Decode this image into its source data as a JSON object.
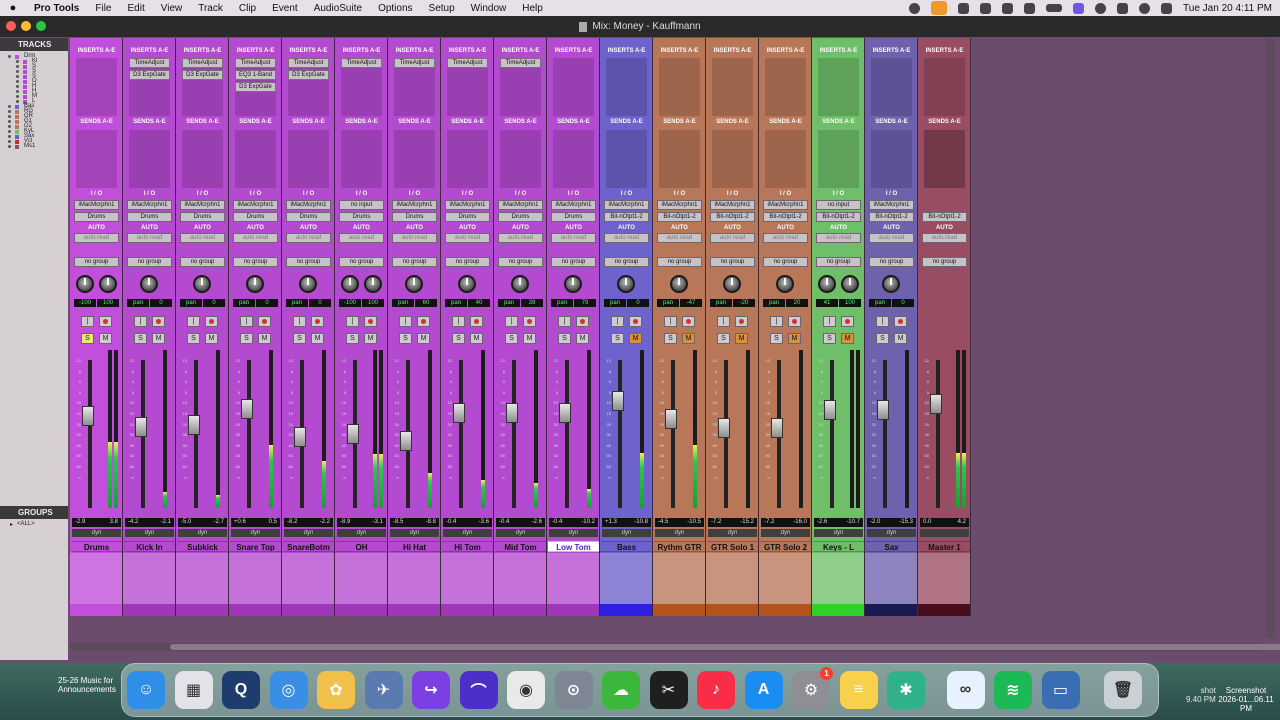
{
  "menubar": {
    "app_name": "Pro Tools",
    "items": [
      "File",
      "Edit",
      "View",
      "Track",
      "Clip",
      "Event",
      "AudioSuite",
      "Options",
      "Setup",
      "Window",
      "Help"
    ],
    "clock": "Tue Jan 20  4:11 PM"
  },
  "window": {
    "title": "Mix: Money - Kauffmann"
  },
  "panels": {
    "tracks_label": "TRACKS",
    "groups_label": "GROUPS",
    "tracks": [
      "Drm",
      "Kl",
      "S",
      "S",
      "S",
      "O",
      "H",
      "H",
      "M",
      "L",
      "Bas",
      "RG",
      "GR",
      "G1",
      "G2",
      "KyL",
      "Sax",
      "Vcl",
      "Ms1"
    ],
    "groups": [
      "<ALL>"
    ]
  },
  "labels": {
    "inserts": "INSERTS A-E",
    "sends": "SENDS A-E",
    "io": "I / O",
    "auto": "AUTO",
    "auto_mode": "auto read",
    "group": "no group",
    "solo": "S",
    "mute": "M",
    "dyn": "dyn"
  },
  "scale_marks": [
    "12",
    "6",
    "0",
    "5",
    "10",
    "15",
    "20",
    "30",
    "40",
    "50",
    "60",
    "∞"
  ],
  "channels": [
    {
      "name": "Drums",
      "color": "#c24fdb",
      "bar": "#c24fdb",
      "plugins": [],
      "input": "iMacMcrphn1",
      "output": "Drums",
      "pan": [
        "-100",
        "100"
      ],
      "readout": [
        "-2.9",
        "3.8"
      ],
      "fader": 0.38,
      "meter": 0.42,
      "stereo": true,
      "solo_on": true,
      "mute_on": false,
      "selected": false
    },
    {
      "name": "Kick In",
      "color": "#b44ad0",
      "bar": "#9e38b9",
      "plugins": [
        "TimeAdjust",
        "D3 ExpGate"
      ],
      "input": "iMacMcrphn1",
      "output": "Drums",
      "pan": [
        "pan",
        "0"
      ],
      "readout": [
        "-4.2",
        "-2.1"
      ],
      "fader": 0.45,
      "meter": 0.1,
      "stereo": false,
      "solo_on": false,
      "mute_on": false,
      "selected": false
    },
    {
      "name": "Subkick",
      "color": "#b44ad0",
      "bar": "#9e38b9",
      "plugins": [
        "TimeAdjust",
        "D3 ExpGate"
      ],
      "input": "iMacMcrphn1",
      "output": "Drums",
      "pan": [
        "pan",
        "0"
      ],
      "readout": [
        "-5.0",
        "-2.7"
      ],
      "fader": 0.44,
      "meter": 0.08,
      "stereo": false,
      "solo_on": false,
      "mute_on": false,
      "selected": false
    },
    {
      "name": "Snare Top",
      "color": "#b44ad0",
      "bar": "#9e38b9",
      "plugins": [
        "TimeAdjust",
        "EQ3 1-Band",
        "D3 ExpGate"
      ],
      "input": "iMacMcrphn1",
      "output": "Drums",
      "pan": [
        "pan",
        "0"
      ],
      "readout": [
        "+0.6",
        "0.5"
      ],
      "fader": 0.33,
      "meter": 0.4,
      "stereo": false,
      "solo_on": false,
      "mute_on": false,
      "selected": false
    },
    {
      "name": "SnareBotm",
      "color": "#b44ad0",
      "bar": "#9e38b9",
      "plugins": [
        "TimeAdjust",
        "D3 ExpGate"
      ],
      "input": "iMacMcrphn1",
      "output": "Drums",
      "pan": [
        "pan",
        "0"
      ],
      "readout": [
        "-8.2",
        "-2.2"
      ],
      "fader": 0.52,
      "meter": 0.3,
      "stereo": false,
      "solo_on": false,
      "mute_on": false,
      "selected": false
    },
    {
      "name": "OH",
      "color": "#b44ad0",
      "bar": "#9e38b9",
      "plugins": [
        "TimeAdjust"
      ],
      "input": "no input",
      "output": "Drums",
      "pan": [
        "-100",
        "100"
      ],
      "readout": [
        "-8.9",
        "-3.1"
      ],
      "fader": 0.5,
      "meter": 0.34,
      "stereo": true,
      "solo_on": false,
      "mute_on": false,
      "selected": false
    },
    {
      "name": "Hi Hat",
      "color": "#b44ad0",
      "bar": "#9e38b9",
      "plugins": [
        "TimeAdjust"
      ],
      "input": "iMacMcrphn1",
      "output": "Drums",
      "pan": [
        "pan",
        "60"
      ],
      "readout": [
        "-8.5",
        "-8.8"
      ],
      "fader": 0.55,
      "meter": 0.22,
      "stereo": false,
      "solo_on": false,
      "mute_on": false,
      "selected": false
    },
    {
      "name": "Hi Tom",
      "color": "#b44ad0",
      "bar": "#9e38b9",
      "plugins": [
        "TimeAdjust"
      ],
      "input": "iMacMcrphn1",
      "output": "Drums",
      "pan": [
        "pan",
        "40"
      ],
      "readout": [
        "-0.4",
        "-3.6"
      ],
      "fader": 0.36,
      "meter": 0.18,
      "stereo": false,
      "solo_on": false,
      "mute_on": false,
      "selected": false
    },
    {
      "name": "Mid Tom",
      "color": "#b44ad0",
      "bar": "#9e38b9",
      "plugins": [
        "TimeAdjust"
      ],
      "input": "iMacMcrphn1",
      "output": "Drums",
      "pan": [
        "pan",
        "39"
      ],
      "readout": [
        "-0.4",
        "-2.6"
      ],
      "fader": 0.36,
      "meter": 0.16,
      "stereo": false,
      "solo_on": false,
      "mute_on": false,
      "selected": false
    },
    {
      "name": "Low Tom",
      "color": "#b44ad0",
      "bar": "#9e38b9",
      "plugins": [],
      "input": "iMacMcrphn1",
      "output": "Drums",
      "pan": [
        "pan",
        "79"
      ],
      "readout": [
        "-0.4",
        "-10.2"
      ],
      "fader": 0.36,
      "meter": 0.12,
      "stereo": false,
      "solo_on": false,
      "mute_on": false,
      "selected": true
    },
    {
      "name": "Bass",
      "color": "#6e62cc",
      "bar": "#2f1fe0",
      "plugins": [],
      "input": "iMacMcrphn1",
      "output": "Bit-nOtpt1-2",
      "pan": [
        "pan",
        "0"
      ],
      "readout": [
        "+1.3",
        "-10.8"
      ],
      "fader": 0.28,
      "meter": 0.35,
      "stereo": false,
      "solo_on": false,
      "mute_on": true,
      "selected": false
    },
    {
      "name": "Rythm GTR",
      "color": "#b9775a",
      "bar": "#b5531c",
      "plugins": [],
      "input": "iMacMcrphn1",
      "output": "Bit-nOtpt1-2",
      "pan": [
        "pan",
        "-47"
      ],
      "readout": [
        "-4.5",
        "-10.5"
      ],
      "fader": 0.4,
      "meter": 0.4,
      "stereo": false,
      "solo_on": false,
      "mute_on": true,
      "selected": false
    },
    {
      "name": "GTR Solo 1",
      "color": "#b9775a",
      "bar": "#b5531c",
      "plugins": [],
      "input": "iMacMcrphn1",
      "output": "Bit-nOtpt1-2",
      "pan": [
        "pan",
        "-20"
      ],
      "readout": [
        "-7.2",
        "-15.2"
      ],
      "fader": 0.46,
      "meter": 0.0,
      "stereo": false,
      "solo_on": false,
      "mute_on": true,
      "selected": false
    },
    {
      "name": "GTR Solo 2",
      "color": "#b9775a",
      "bar": "#b5531c",
      "plugins": [],
      "input": "iMacMcrphn1",
      "output": "Bit-nOtpt1-2",
      "pan": [
        "pan",
        "20"
      ],
      "readout": [
        "-7.2",
        "-16.0"
      ],
      "fader": 0.46,
      "meter": 0.0,
      "stereo": false,
      "solo_on": false,
      "mute_on": true,
      "selected": false
    },
    {
      "name": "Keys - L",
      "color": "#6fbf6a",
      "bar": "#2ed12a",
      "plugins": [],
      "input": "no input",
      "output": "Bit-nOtpt1-2",
      "pan": [
        "41",
        "100"
      ],
      "readout": [
        "-2.6",
        "-10.7"
      ],
      "fader": 0.34,
      "meter": 0.0,
      "stereo": true,
      "solo_on": false,
      "mute_on": true,
      "selected": false
    },
    {
      "name": "Sax",
      "color": "#6e62ae",
      "bar": "#1a1a52",
      "plugins": [],
      "input": "iMacMcrphn1",
      "output": "Bit-nOtpt1-2",
      "pan": [
        "pan",
        "0"
      ],
      "readout": [
        "-2.0",
        "-15.3"
      ],
      "fader": 0.34,
      "meter": 0.0,
      "stereo": false,
      "solo_on": false,
      "mute_on": false,
      "selected": false
    },
    {
      "name": "Master 1",
      "color": "#9a4c62",
      "bar": "#4a0d1d",
      "plugins": [],
      "input": "",
      "output": "Bit-nOtpt1-2",
      "pan": [],
      "readout": [
        "0.0",
        "4.2"
      ],
      "fader": 0.3,
      "meter": 0.35,
      "stereo": true,
      "solo_on": false,
      "mute_on": false,
      "selected": false,
      "master": true
    }
  ],
  "dock": {
    "badge": "1",
    "apps": [
      {
        "name": "finder-icon",
        "color": "#2f8fe8",
        "glyph": "☺"
      },
      {
        "name": "launchpad-icon",
        "color": "#e2e2e8",
        "glyph": "▦"
      },
      {
        "name": "quicktime-icon",
        "color": "#1e3c6e",
        "glyph": "Q"
      },
      {
        "name": "safari-icon",
        "color": "#3a8ee6",
        "glyph": "◎"
      },
      {
        "name": "photos-icon",
        "color": "#f0c04a",
        "glyph": "✿"
      },
      {
        "name": "migration-icon",
        "color": "#5a7ab0",
        "glyph": "✈"
      },
      {
        "name": "keyboard-icon",
        "color": "#7b3fe4",
        "glyph": "↪"
      },
      {
        "name": "pro-tools-icon",
        "color": "#4b2fc8",
        "glyph": "⌒"
      },
      {
        "name": "chrome-icon",
        "color": "#e9e9e9",
        "glyph": "◉"
      },
      {
        "name": "audio-icon",
        "color": "#7e8694",
        "glyph": "⊙"
      },
      {
        "name": "icloud-icon",
        "color": "#3bb83b",
        "glyph": "☁"
      },
      {
        "name": "finalcut-icon",
        "color": "#1f1f1f",
        "glyph": "✂"
      },
      {
        "name": "music-icon",
        "color": "#fa2d48",
        "glyph": "♪"
      },
      {
        "name": "appstore-icon",
        "color": "#1b8cf2",
        "glyph": "A"
      },
      {
        "name": "settings-icon",
        "color": "#8e8e93",
        "glyph": "⚙"
      },
      {
        "name": "notes-icon",
        "color": "#f7d14b",
        "glyph": "≡"
      },
      {
        "name": "slack-icon",
        "color": "#2fb28a",
        "glyph": "✱"
      },
      {
        "name": "vpn-icon",
        "color": "#e8f1ff",
        "glyph": "∞"
      },
      {
        "name": "spotify-icon",
        "color": "#1db954",
        "glyph": "≋"
      },
      {
        "name": "preview-icon",
        "color": "#3a6eb2",
        "glyph": "▭"
      },
      {
        "name": "trash-icon",
        "color": "#c9d0d6",
        "glyph": "🗑"
      }
    ]
  },
  "desktop": {
    "left_file": [
      "25-26 Music for",
      "Announcements"
    ],
    "right_file": [
      "Screenshot",
      "2026-01...06.11 PM"
    ],
    "right_file2": [
      "shot",
      "9.40 PM"
    ]
  }
}
